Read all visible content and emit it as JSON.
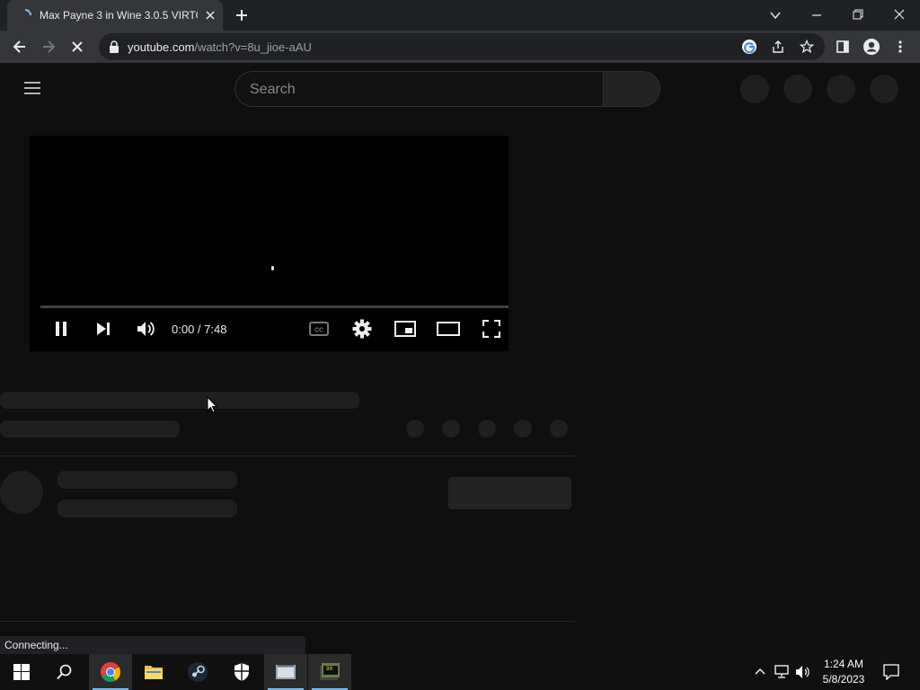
{
  "browser": {
    "tab_title": "Max Payne 3 in Wine 3.0.5 VIRTO",
    "url_host": "youtube.com",
    "url_path": "/watch?v=8u_jioe-aAU",
    "status_text": "Connecting..."
  },
  "youtube": {
    "search_placeholder": "Search",
    "player": {
      "time_display": "0:00 / 7:48"
    }
  },
  "taskbar": {
    "items": [
      "start",
      "search",
      "chrome",
      "file-explorer",
      "steam",
      "windows-security",
      "app-5",
      "app-6"
    ],
    "time": "1:24 AM",
    "date": "5/8/2023"
  },
  "colors": {
    "page_background": "#0f0f0f",
    "browser_frame": "#202124",
    "toolbar": "#35363a",
    "taskbar": "#101010",
    "taskbar_active_accent": "#76b9ed"
  },
  "icons": [
    "loading-spinner-icon",
    "close-icon",
    "new-tab-icon",
    "back-arrow-icon",
    "forward-arrow-icon",
    "stop-loading-icon",
    "lock-icon",
    "google-lens-icon",
    "share-icon",
    "star-icon",
    "side-panel-icon",
    "profile-icon",
    "more-menu-icon",
    "hamburger-menu-icon",
    "pause-icon",
    "next-icon",
    "volume-icon",
    "captions-icon",
    "settings-gear-icon",
    "miniplayer-icon",
    "theater-mode-icon",
    "fullscreen-icon",
    "windows-start-icon",
    "search-icon",
    "chevron-up-icon",
    "network-icon",
    "speaker-icon",
    "notifications-icon"
  ]
}
